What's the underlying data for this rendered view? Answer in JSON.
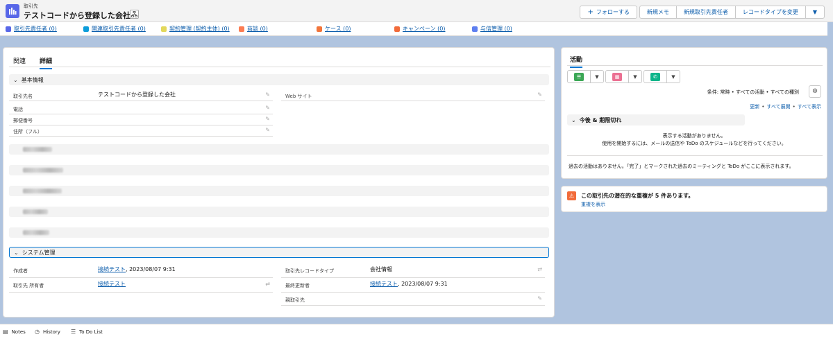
{
  "header": {
    "object_label": "取引先",
    "title": "テストコードから登録した会社",
    "buttons": [
      {
        "label": "フォローする",
        "icon": "plus-icon"
      },
      {
        "label": "新規メモ"
      },
      {
        "label": "新規取引先責任者"
      },
      {
        "label": "レコードタイプを変更"
      }
    ],
    "more_icon": "chevron-down-icon"
  },
  "related": [
    {
      "label": "取引先責任者 (0)",
      "color": "#5867e8"
    },
    {
      "label": "関連取引先責任者 (0)",
      "color": "#0d9dda"
    },
    {
      "label": "契約管理 (契約主体) (0)",
      "color": "#e3d85b"
    },
    {
      "label": "商談 (0)",
      "color": "#fc7c52"
    },
    {
      "label": "ケース (0)",
      "color": "#f2753b"
    },
    {
      "label": "キャンペーン (0)",
      "color": "#f26b3a"
    },
    {
      "label": "与信管理 (0)",
      "color": "#5e7ff0"
    }
  ],
  "tabs": [
    "関連",
    "詳細"
  ],
  "basic": {
    "title": "基本情報",
    "fields_left": [
      {
        "label": "取引先名",
        "value": "テストコードから登録した会社"
      },
      {
        "label": "電話",
        "value": ""
      },
      {
        "label": "郵便番号",
        "value": ""
      },
      {
        "label": "住所（フル）",
        "value": ""
      }
    ],
    "fields_right": [
      {
        "label": "Web サイト",
        "value": ""
      }
    ]
  },
  "system": {
    "title": "システム管理",
    "created_label": "作成者",
    "created_user": "接続テスト",
    "created_date": ", 2023/08/07 9:31",
    "owner_label": "取引先 所有者",
    "owner_user": "接続テスト",
    "rtype_label": "取引先レコードタイプ",
    "rtype_value": "会社情報",
    "modified_label": "最終更新者",
    "modified_user": "接続テスト",
    "modified_date": ", 2023/08/07 9:31",
    "parent_label": "親取引先"
  },
  "activity": {
    "tab": "活動",
    "buttons": [
      {
        "icon": "task-icon",
        "color": "#3ba755"
      },
      {
        "icon": "calendar-icon",
        "color": "#eb7092"
      },
      {
        "icon": "phone-icon",
        "color": "#0eb58a"
      }
    ],
    "filter": "条件: 常時 • すべての活動 • すべての種別",
    "links": [
      "更新",
      "すべて展開",
      "すべて表示"
    ],
    "upcoming": "今後 & 期限切れ",
    "no_activity_1": "表示する活動がありません。",
    "no_activity_2": "使用を開始するには、メールの送信や ToDo のスケジュールなどを行ってください。",
    "past": "過去の活動はありません。「完了」とマークされた過去のミーティングと ToDo がここに表示されます。"
  },
  "duplicate": {
    "message": "この取引先の潜在的な重複が 5 件あります。",
    "link": "重複を表示"
  },
  "utility": [
    {
      "label": "Notes",
      "icon": "notes-icon"
    },
    {
      "label": "History",
      "icon": "history-icon"
    },
    {
      "label": "To Do List",
      "icon": "todo-list-icon"
    }
  ]
}
